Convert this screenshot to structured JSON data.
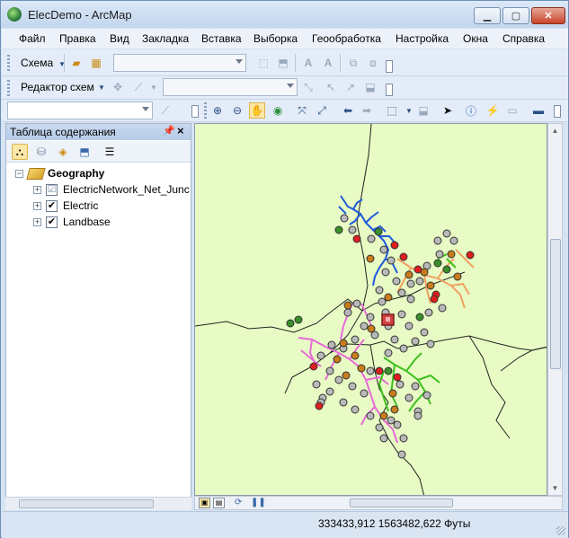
{
  "window": {
    "title": "ElecDemo - ArcMap"
  },
  "menu": [
    "Файл",
    "Правка",
    "Вид",
    "Закладка",
    "Вставка",
    "Выборка",
    "Геообработка",
    "Настройка",
    "Окна",
    "Справка"
  ],
  "toolbar1": {
    "schema_label": "Схема"
  },
  "toolbar2": {
    "editor_label": "Редактор схем"
  },
  "toc": {
    "title": "Таблица содержания",
    "layers": [
      {
        "label": "Geography",
        "level": 0,
        "expanded": true
      },
      {
        "label": "ElectricNetwork_Net_Junc",
        "level": 1,
        "checked": "partial"
      },
      {
        "label": "Electric",
        "level": 1,
        "checked": true
      },
      {
        "label": "Landbase",
        "level": 1,
        "checked": true
      }
    ]
  },
  "status": {
    "coords": "333433,912  1563482,622 Футы"
  },
  "colors": {
    "map_background": "#e8fbc4",
    "network_blue": "#1e5adc",
    "network_orange": "#f0a060",
    "network_pink": "#e86ad8",
    "network_green": "#3fbf1f",
    "accent": "#6d8fb8"
  }
}
